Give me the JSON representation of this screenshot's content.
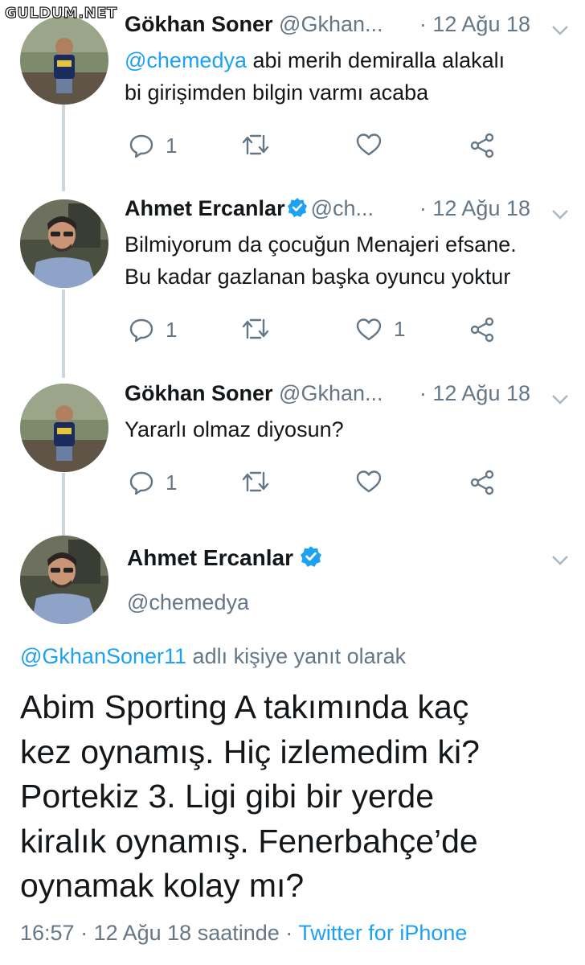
{
  "watermark": "GULDUM.NET",
  "colors": {
    "link": "#1da1f2",
    "muted": "#657786",
    "text": "#14171a",
    "verified": "#1da1f2",
    "thread_line": "#ccd6dd"
  },
  "tweets": [
    {
      "name": "Gökhan Soner",
      "verified": false,
      "handle": "@Gkhan...",
      "sep": "·",
      "date": "12 Ağu 18",
      "mention": "@chemedya",
      "text_after_mention": " abi merih demiralla alakalı",
      "text_line2": "bi girişimden bilgin varmı acaba",
      "reply_count": "1",
      "like_count": "",
      "avatar_icon": "user-avatar-photo"
    },
    {
      "name": "Ahmet Ercanlar",
      "verified": true,
      "handle": "@ch...",
      "sep": "·",
      "date": "12 Ağu 18",
      "text_line1": "Bilmiyorum da çocuğun Menajeri efsane.",
      "text_line2": "Bu kadar gazlanan başka oyuncu yoktur",
      "reply_count": "1",
      "like_count": "1",
      "avatar_icon": "user-avatar-photo"
    },
    {
      "name": "Gökhan Soner",
      "verified": false,
      "handle": "@Gkhan...",
      "sep": "·",
      "date": "12 Ağu 18",
      "text_line1": "Yararlı olmaz diyosun?",
      "reply_count": "1",
      "like_count": "",
      "avatar_icon": "user-avatar-photo"
    }
  ],
  "main_tweet": {
    "name": "Ahmet Ercanlar",
    "verified": true,
    "handle": "@chemedya",
    "reply_to_mention": "@GkhanSoner11",
    "reply_to_suffix": " adlı kişiye yanıt olarak",
    "text_lines": [
      "Abim Sporting A takımında kaç",
      "kez oynamış. Hiç izlemedim ki?",
      "Portekiz 3. Ligi gibi bir yerde",
      "kiralık oynamış. Fenerbahçe’de",
      "oynamak kolay mı?"
    ],
    "time": "16:57",
    "sep1": " · ",
    "date_text": "12 Ağu 18 saatinde",
    "sep2": " · ",
    "source": "Twitter for iPhone"
  },
  "icons": [
    "reply-icon",
    "retweet-icon",
    "like-icon",
    "share-icon",
    "chevron-down-icon",
    "verified-badge-icon"
  ]
}
